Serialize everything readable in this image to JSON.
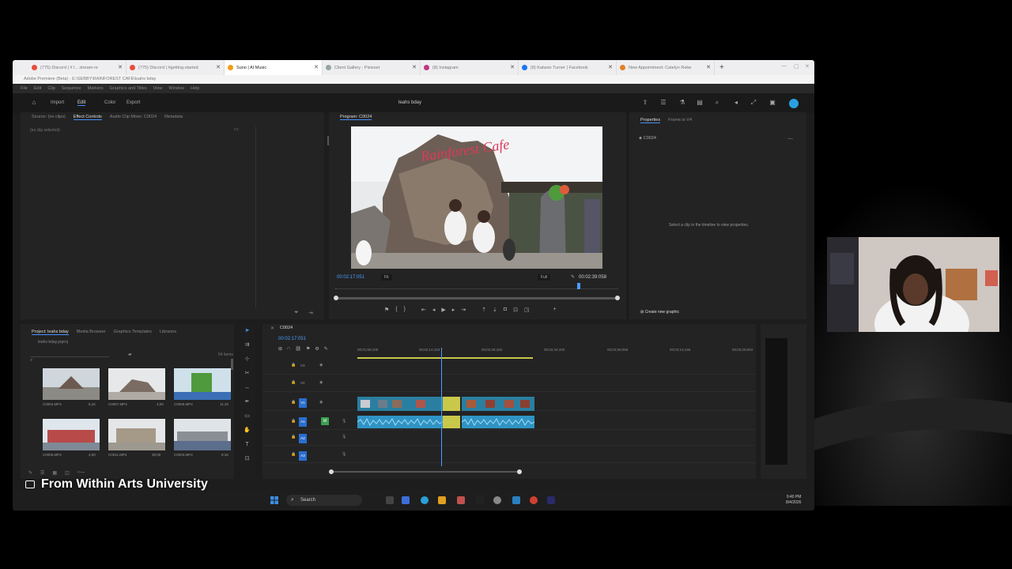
{
  "browser": {
    "tabs": [
      {
        "label": "(775) Discord | # l... stream-re",
        "color": "#e74c3c"
      },
      {
        "label": "(775) Discord | #getting-started",
        "color": "#e74c3c"
      },
      {
        "label": "Suno | AI Music",
        "color": "#f39c12"
      },
      {
        "label": "Client Gallery - Pixieset",
        "color": "#95a5a6"
      },
      {
        "label": "(8) Instagram",
        "color": "#c13584"
      },
      {
        "label": "(8) Katwon Turner | Facebook",
        "color": "#1877f2"
      },
      {
        "label": "New Appointment: Catelyn Rebe",
        "color": "#e67e22"
      }
    ],
    "active_tab": 2,
    "new_tab": "+",
    "title": "Adobe Premiere (Beta) - E:\\SEBBY\\RAINFOREST CAFE\\luahs bday"
  },
  "premiere": {
    "menu": [
      "File",
      "Edit",
      "Clip",
      "Sequence",
      "Markers",
      "Graphics and Titles",
      "View",
      "Window",
      "Help"
    ],
    "header": {
      "import": "Import",
      "edit": "Edit",
      "color": "Color",
      "export": "Export",
      "project_name": "leahs bday"
    },
    "source_tabs": [
      "Source: (no clips)",
      "Effect Controls",
      "Audio Clip Mixer: C0024",
      "Metadata"
    ],
    "no_clip": "(no clip selected)",
    "program": {
      "tab": "Program: C0024",
      "timecode_left": "00:02:17:051",
      "fit": "Fit",
      "full": "Full",
      "timecode_right": "00:02:39:058",
      "sign_text": "Rainforest Cafe"
    },
    "properties": {
      "tabs": [
        "Properties",
        "Frame.io V4"
      ],
      "item": "C0024",
      "message": "Select a clip in the timeline to view properties.",
      "create_graphic": "Create new graphic"
    },
    "project": {
      "tabs": [
        "Project: leahs bday",
        "Media Browser",
        "Graphics Templates",
        "Libraries"
      ],
      "file": "leahs bday.prproj",
      "item_count": "54 items",
      "thumbs": [
        {
          "name": "C0004.MP4",
          "dur": "5;15"
        },
        {
          "name": "C0007.MP4",
          "dur": "4;00"
        },
        {
          "name": "C0006.MP4",
          "dur": "11;15"
        },
        {
          "name": "C0005.MP4",
          "dur": "4;00"
        },
        {
          "name": "C0011.MP4",
          "dur": "30;00"
        },
        {
          "name": "C0003.MP4",
          "dur": "9;15"
        }
      ]
    },
    "timeline": {
      "tab": "C0024",
      "timecode": "00:02:17:051",
      "marks": [
        "00;01;59;105",
        "00;02;14;153",
        "00;02;29;182",
        "00;02;44;100",
        "00;02;59;096",
        "00;03;14;166",
        "00;03;29;004"
      ],
      "video_tracks": [
        "V3",
        "V2",
        "V1"
      ],
      "audio_tracks": [
        "A1",
        "A2",
        "A3"
      ]
    }
  },
  "taskbar": {
    "search": "Search",
    "time": "9:40 PM",
    "date": "8/4/2026"
  },
  "caption": "From Within Arts University",
  "colors": {
    "accent": "#4a9cff",
    "clip_video": "#2a7fa0",
    "clip_audio": "#2f94c4",
    "clip_selected": "#c9c84a"
  }
}
